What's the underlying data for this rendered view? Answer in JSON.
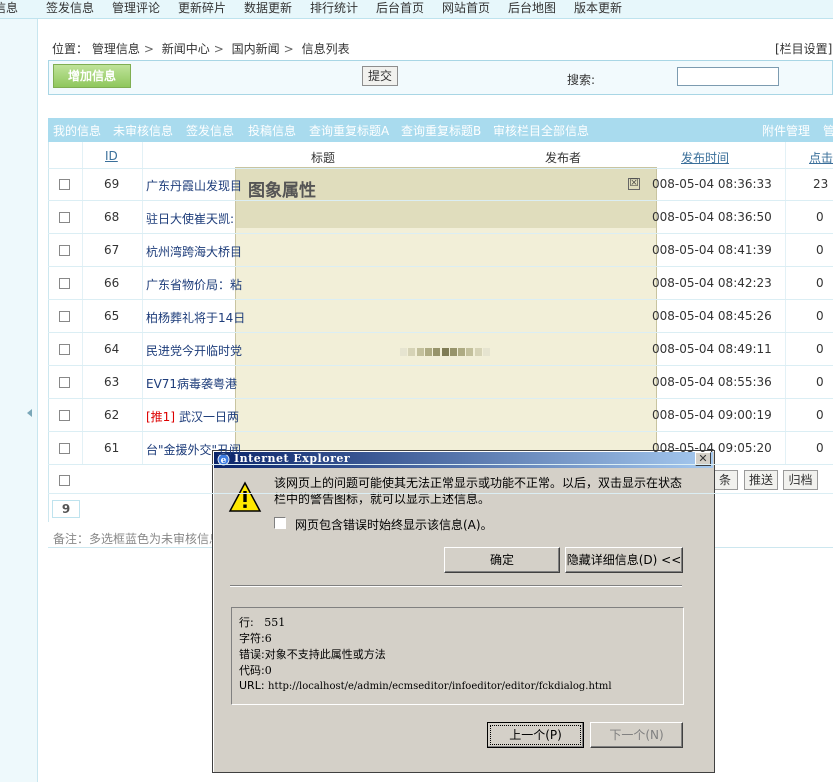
{
  "topnav": {
    "items": [
      "信息",
      "签发信息",
      "管理评论",
      "更新碎片",
      "数据更新",
      "排行统计",
      "后台首页",
      "网站首页",
      "后台地图",
      "版本更新"
    ]
  },
  "breadcrumb": {
    "label": "位置：",
    "items": [
      "管理信息",
      "新闻中心",
      "国内新闻",
      "信息列表"
    ],
    "separator": ">"
  },
  "column_settings": "[栏目设置]",
  "toolbar": {
    "add_label": "增加信息",
    "submit_label": "提交",
    "search_label": "搜索:",
    "search_value": ""
  },
  "filters": {
    "items": [
      "我的信息",
      "未审核信息",
      "签发信息",
      "投稿信息",
      "查询重复标题A",
      "查询重复标题B",
      "审核栏目全部信息"
    ],
    "right": [
      "附件管理",
      "管"
    ]
  },
  "table": {
    "headers": {
      "id": "ID",
      "title": "标题",
      "publisher": "发布者",
      "time": "发布时间",
      "clicks": "点击"
    },
    "rows": [
      {
        "id": "69",
        "tag": "",
        "title": "广东丹霞山发现目",
        "time": "008-05-04 08:36:33",
        "clicks": "23"
      },
      {
        "id": "68",
        "tag": "",
        "title": "驻日大使崔天凯:",
        "time": "008-05-04 08:36:50",
        "clicks": "0"
      },
      {
        "id": "67",
        "tag": "",
        "title": "杭州湾跨海大桥目",
        "time": "008-05-04 08:41:39",
        "clicks": "0"
      },
      {
        "id": "66",
        "tag": "",
        "title": "广东省物价局：粘",
        "time": "008-05-04 08:42:23",
        "clicks": "0"
      },
      {
        "id": "65",
        "tag": "",
        "title": "柏杨葬礼将于14日",
        "time": "008-05-04 08:45:26",
        "clicks": "0"
      },
      {
        "id": "64",
        "tag": "",
        "title": "民进党今开临时党",
        "time": "008-05-04 08:49:11",
        "clicks": "0"
      },
      {
        "id": "63",
        "tag": "",
        "title": "EV71病毒袭粤港",
        "time": "008-05-04 08:55:36",
        "clicks": "0"
      },
      {
        "id": "62",
        "tag": "[推1]",
        "title": "武汉一日两",
        "time": "008-05-04 09:00:19",
        "clicks": "0"
      },
      {
        "id": "61",
        "tag": "",
        "title": "台\"金援外交\"丑闻",
        "time": "008-05-04 09:05:20",
        "clicks": "0"
      }
    ]
  },
  "actions": {
    "more": "条",
    "push": "推送",
    "archive": "归档"
  },
  "pagination": {
    "current": "9"
  },
  "note": "备注：多选框蓝色为未审核信息",
  "image_dialog": {
    "title": "图象属性",
    "close": "☒",
    "loader_colors": [
      "#e6e4d0",
      "#d6d3b6",
      "#c3c09c",
      "#aeab83",
      "#97946b",
      "#7f7c55",
      "#97946b",
      "#aeab83",
      "#c3c09c",
      "#d6d3b6",
      "#e6e4d0"
    ]
  },
  "ie_dialog": {
    "title": "Internet Explorer",
    "close": "✕",
    "message": "该网页上的问题可能使其无法正常显示或功能不正常。以后，双击显示在状态栏中的警告图标，就可以显示上述信息。",
    "checkbox_label": "网页包含错误时始终显示该信息(A)。",
    "ok_label": "确定",
    "hide_label": "隐藏详细信息(D)  <<",
    "details": {
      "line_label": "行:",
      "line": "551",
      "char_label": "字符:",
      "char": "6",
      "error_label": "错误:",
      "error": "对象不支持此属性或方法",
      "code_label": "代码:",
      "code": "0",
      "url_label": "URL:",
      "url": "http://localhost/e/admin/ecmseditor/infoeditor/editor/fckdialog.html"
    },
    "prev_label": "上一个(P)",
    "next_label": "下一个(N)"
  }
}
